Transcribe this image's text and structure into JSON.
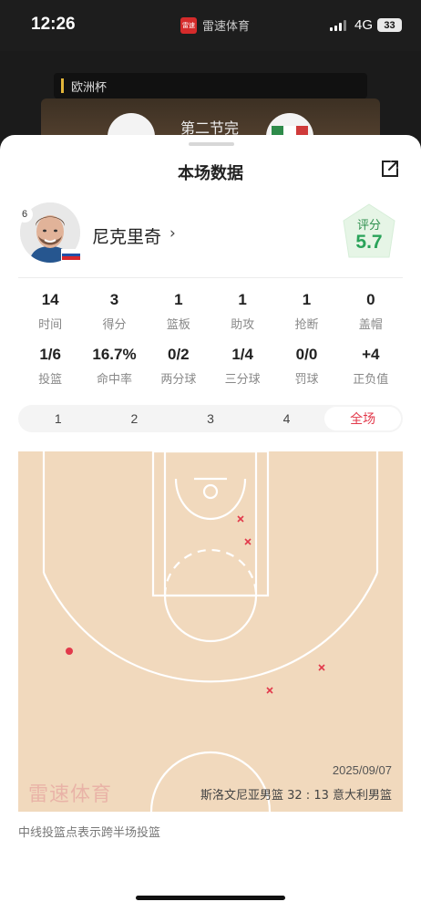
{
  "status_bar": {
    "time": "12:26",
    "brand_name": "雷速体育",
    "brand_logo_text": "雷速",
    "network": "4G",
    "battery": "33"
  },
  "background": {
    "league": "欧洲杯",
    "period": "第二节完"
  },
  "sheet": {
    "title": "本场数据",
    "share_icon": "share-icon"
  },
  "player": {
    "jersey_number": "6",
    "name": "尼克里奇",
    "chevron": "›",
    "rating_label": "评分",
    "rating_value": "5.7",
    "rating_color": "#2aa35a"
  },
  "stats_row1": [
    {
      "value": "14",
      "label": "时间"
    },
    {
      "value": "3",
      "label": "得分"
    },
    {
      "value": "1",
      "label": "篮板"
    },
    {
      "value": "1",
      "label": "助攻"
    },
    {
      "value": "1",
      "label": "抢断"
    },
    {
      "value": "0",
      "label": "盖帽"
    }
  ],
  "stats_row2": [
    {
      "value": "1/6",
      "label": "投篮"
    },
    {
      "value": "16.7%",
      "label": "命中率"
    },
    {
      "value": "0/2",
      "label": "两分球"
    },
    {
      "value": "1/4",
      "label": "三分球"
    },
    {
      "value": "0/0",
      "label": "罚球"
    },
    {
      "value": "+4",
      "label": "正负值"
    }
  ],
  "period_tabs": [
    {
      "label": "1",
      "active": false
    },
    {
      "label": "2",
      "active": false
    },
    {
      "label": "3",
      "active": false
    },
    {
      "label": "4",
      "active": false
    },
    {
      "label": "全场",
      "active": true
    }
  ],
  "shot_chart": {
    "watermark": "雷速体育",
    "date": "2025/09/07",
    "score_line": "斯洛文尼亚男篮 32 : 13 意大利男篮",
    "made_color": "#e2394b",
    "miss_color": "#e2394b",
    "shots_made": 1,
    "shots_missed": 5
  },
  "footnote": "中线投篮点表示跨半场投篮",
  "accent_color": "#e2394b"
}
